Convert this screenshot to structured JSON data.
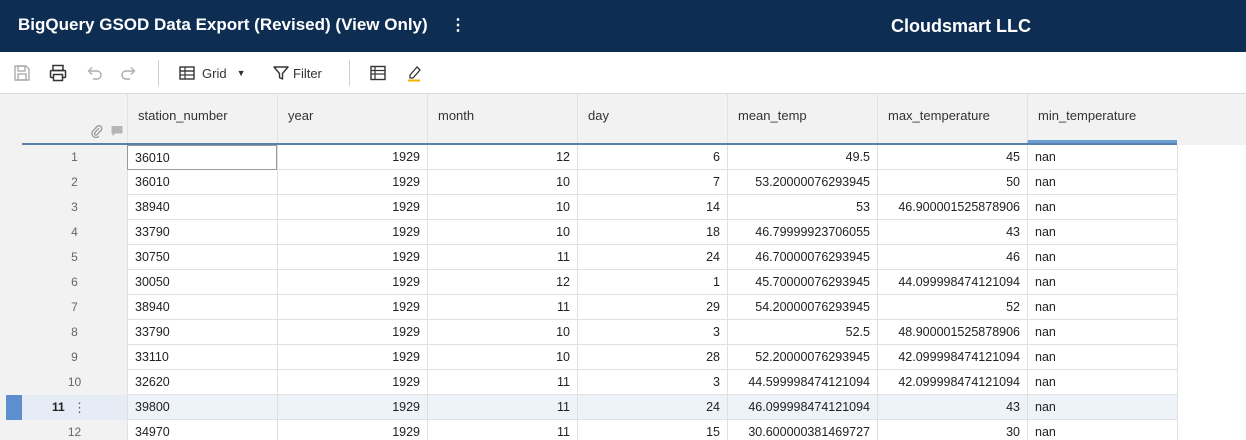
{
  "title_bar": {
    "document_title": "BigQuery GSOD Data Export (Revised) (View Only)",
    "menu_glyph": "⋮",
    "org_name": "Cloudsmart LLC"
  },
  "toolbar": {
    "save_icon": "save-icon",
    "print_icon": "print-icon",
    "undo_icon": "undo-icon",
    "redo_icon": "redo-icon",
    "view_label": "Grid",
    "view_caret": "▼",
    "filter_label": "Filter",
    "card_view_icon": "table-view-icon",
    "highlight_icon": "highlight-changes-icon"
  },
  "colors": {
    "title_bg": "#0e2d52",
    "selected_row_marker": "#5d8fcf",
    "active_column_bar": "#6a9fd4",
    "highlight_pen_accent": "#f0b400"
  },
  "grid": {
    "columns": [
      "station_number",
      "year",
      "month",
      "day",
      "mean_temp",
      "max_temperature",
      "min_temperature"
    ],
    "rows": [
      {
        "n": "1",
        "cells": [
          "36010",
          "1929",
          "12",
          "6",
          "49.5",
          "45",
          "nan"
        ]
      },
      {
        "n": "2",
        "cells": [
          "36010",
          "1929",
          "10",
          "7",
          "53.20000076293945",
          "50",
          "nan"
        ]
      },
      {
        "n": "3",
        "cells": [
          "38940",
          "1929",
          "10",
          "14",
          "53",
          "46.900001525878906",
          "nan"
        ]
      },
      {
        "n": "4",
        "cells": [
          "33790",
          "1929",
          "10",
          "18",
          "46.79999923706055",
          "43",
          "nan"
        ]
      },
      {
        "n": "5",
        "cells": [
          "30750",
          "1929",
          "11",
          "24",
          "46.70000076293945",
          "46",
          "nan"
        ]
      },
      {
        "n": "6",
        "cells": [
          "30050",
          "1929",
          "12",
          "1",
          "45.70000076293945",
          "44.099998474121094",
          "nan"
        ]
      },
      {
        "n": "7",
        "cells": [
          "38940",
          "1929",
          "11",
          "29",
          "54.20000076293945",
          "52",
          "nan"
        ]
      },
      {
        "n": "8",
        "cells": [
          "33790",
          "1929",
          "10",
          "3",
          "52.5",
          "48.900001525878906",
          "nan"
        ]
      },
      {
        "n": "9",
        "cells": [
          "33110",
          "1929",
          "10",
          "28",
          "52.20000076293945",
          "42.099998474121094",
          "nan"
        ]
      },
      {
        "n": "10",
        "cells": [
          "32620",
          "1929",
          "11",
          "3",
          "44.599998474121094",
          "42.099998474121094",
          "nan"
        ]
      },
      {
        "n": "11",
        "cells": [
          "39800",
          "1929",
          "11",
          "24",
          "46.099998474121094",
          "43",
          "nan"
        ]
      },
      {
        "n": "12",
        "cells": [
          "34970",
          "1929",
          "11",
          "15",
          "30.600000381469727",
          "30",
          "nan"
        ]
      }
    ],
    "selected_row": "11",
    "row_menu_glyph": "⋮"
  }
}
